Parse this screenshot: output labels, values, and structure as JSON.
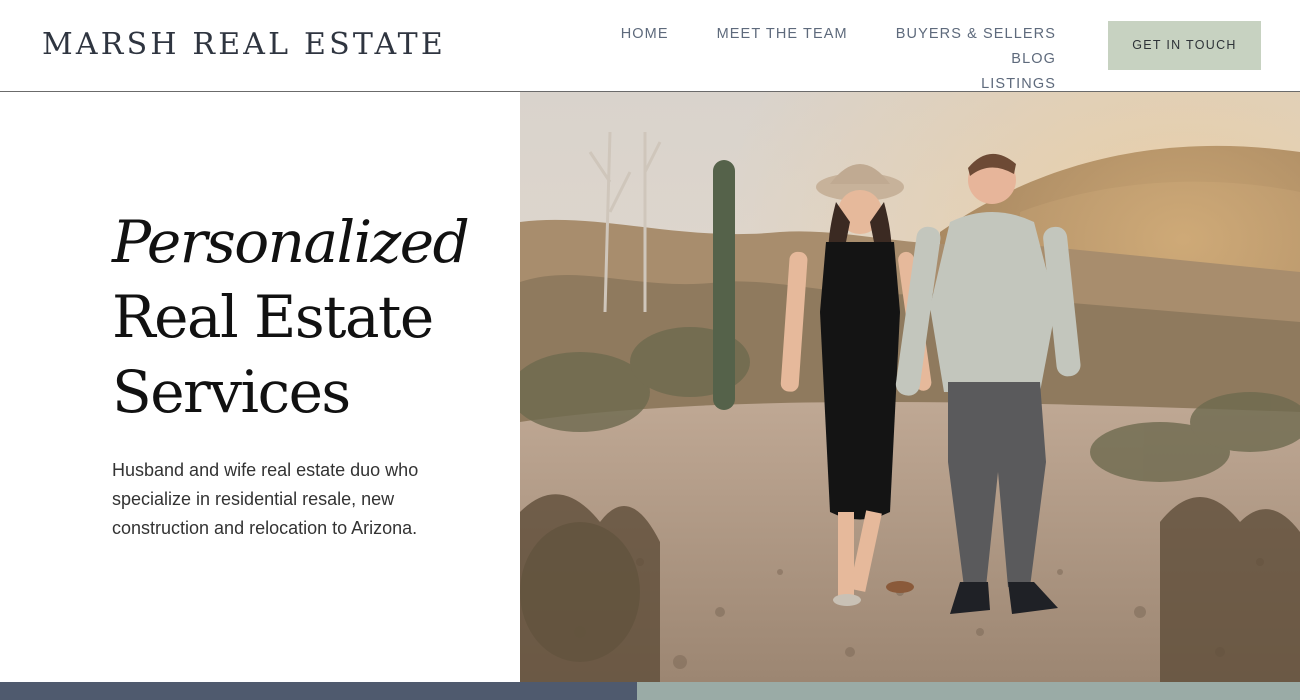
{
  "brand": {
    "logo": "MARSH REAL ESTATE"
  },
  "nav": {
    "items": [
      {
        "label": "HOME"
      },
      {
        "label": "MEET THE TEAM"
      },
      {
        "label": "BUYERS & SELLERS"
      },
      {
        "label": "BLOG"
      },
      {
        "label": "LISTINGS"
      }
    ],
    "cta_label": "GET IN TOUCH"
  },
  "hero": {
    "headline_line1": "Personalized",
    "headline_line2": "Real Estate",
    "headline_line3": "Services",
    "description": "Husband and wife real estate duo who specialize in residential resale, new construction and relocation to Arizona."
  },
  "colors": {
    "cta_bg": "#c7d2c1",
    "band_left": "#4f5a6e",
    "band_right": "#9aaba6",
    "text_dark": "#111111",
    "nav_text": "#5e6a7c"
  }
}
